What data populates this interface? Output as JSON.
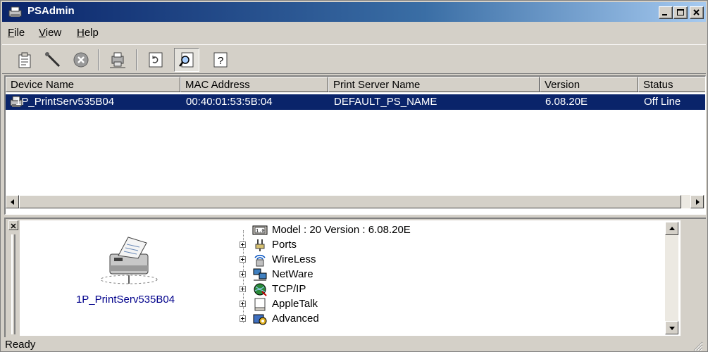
{
  "window": {
    "title": "PSAdmin"
  },
  "menu": [
    {
      "mnemonic": "F",
      "rest": "ile"
    },
    {
      "mnemonic": "V",
      "rest": "iew"
    },
    {
      "mnemonic": "H",
      "rest": "elp"
    }
  ],
  "toolbar": {
    "tools": [
      "properties-icon",
      "wrench-icon",
      "stop-icon",
      "network-printer-icon",
      "refresh-icon",
      "search-icon",
      "help-icon"
    ],
    "pressed_tool": "search-icon"
  },
  "list": {
    "columns": [
      "Device Name",
      "MAC Address",
      "Print Server Name",
      "Version",
      "Status"
    ],
    "rows": [
      {
        "device_name": "1P_PrintServ535B04",
        "mac": "00:40:01:53:5B:04",
        "server_name": "DEFAULT_PS_NAME",
        "version": "6.08.20E",
        "status": "Off Line",
        "selected": true
      }
    ]
  },
  "details": {
    "device_label": "1P_PrintServ535B04",
    "model_line": "Model : 20   Version : 6.08.20E",
    "tree": [
      "Ports",
      "WireLess",
      "NetWare",
      "TCP/IP",
      "AppleTalk",
      "Advanced"
    ]
  },
  "status": {
    "text": "Ready"
  },
  "colors": {
    "title_start": "#0a246a",
    "selection": "#0a246a",
    "face": "#d4d0c8",
    "device_label": "#00008b"
  }
}
